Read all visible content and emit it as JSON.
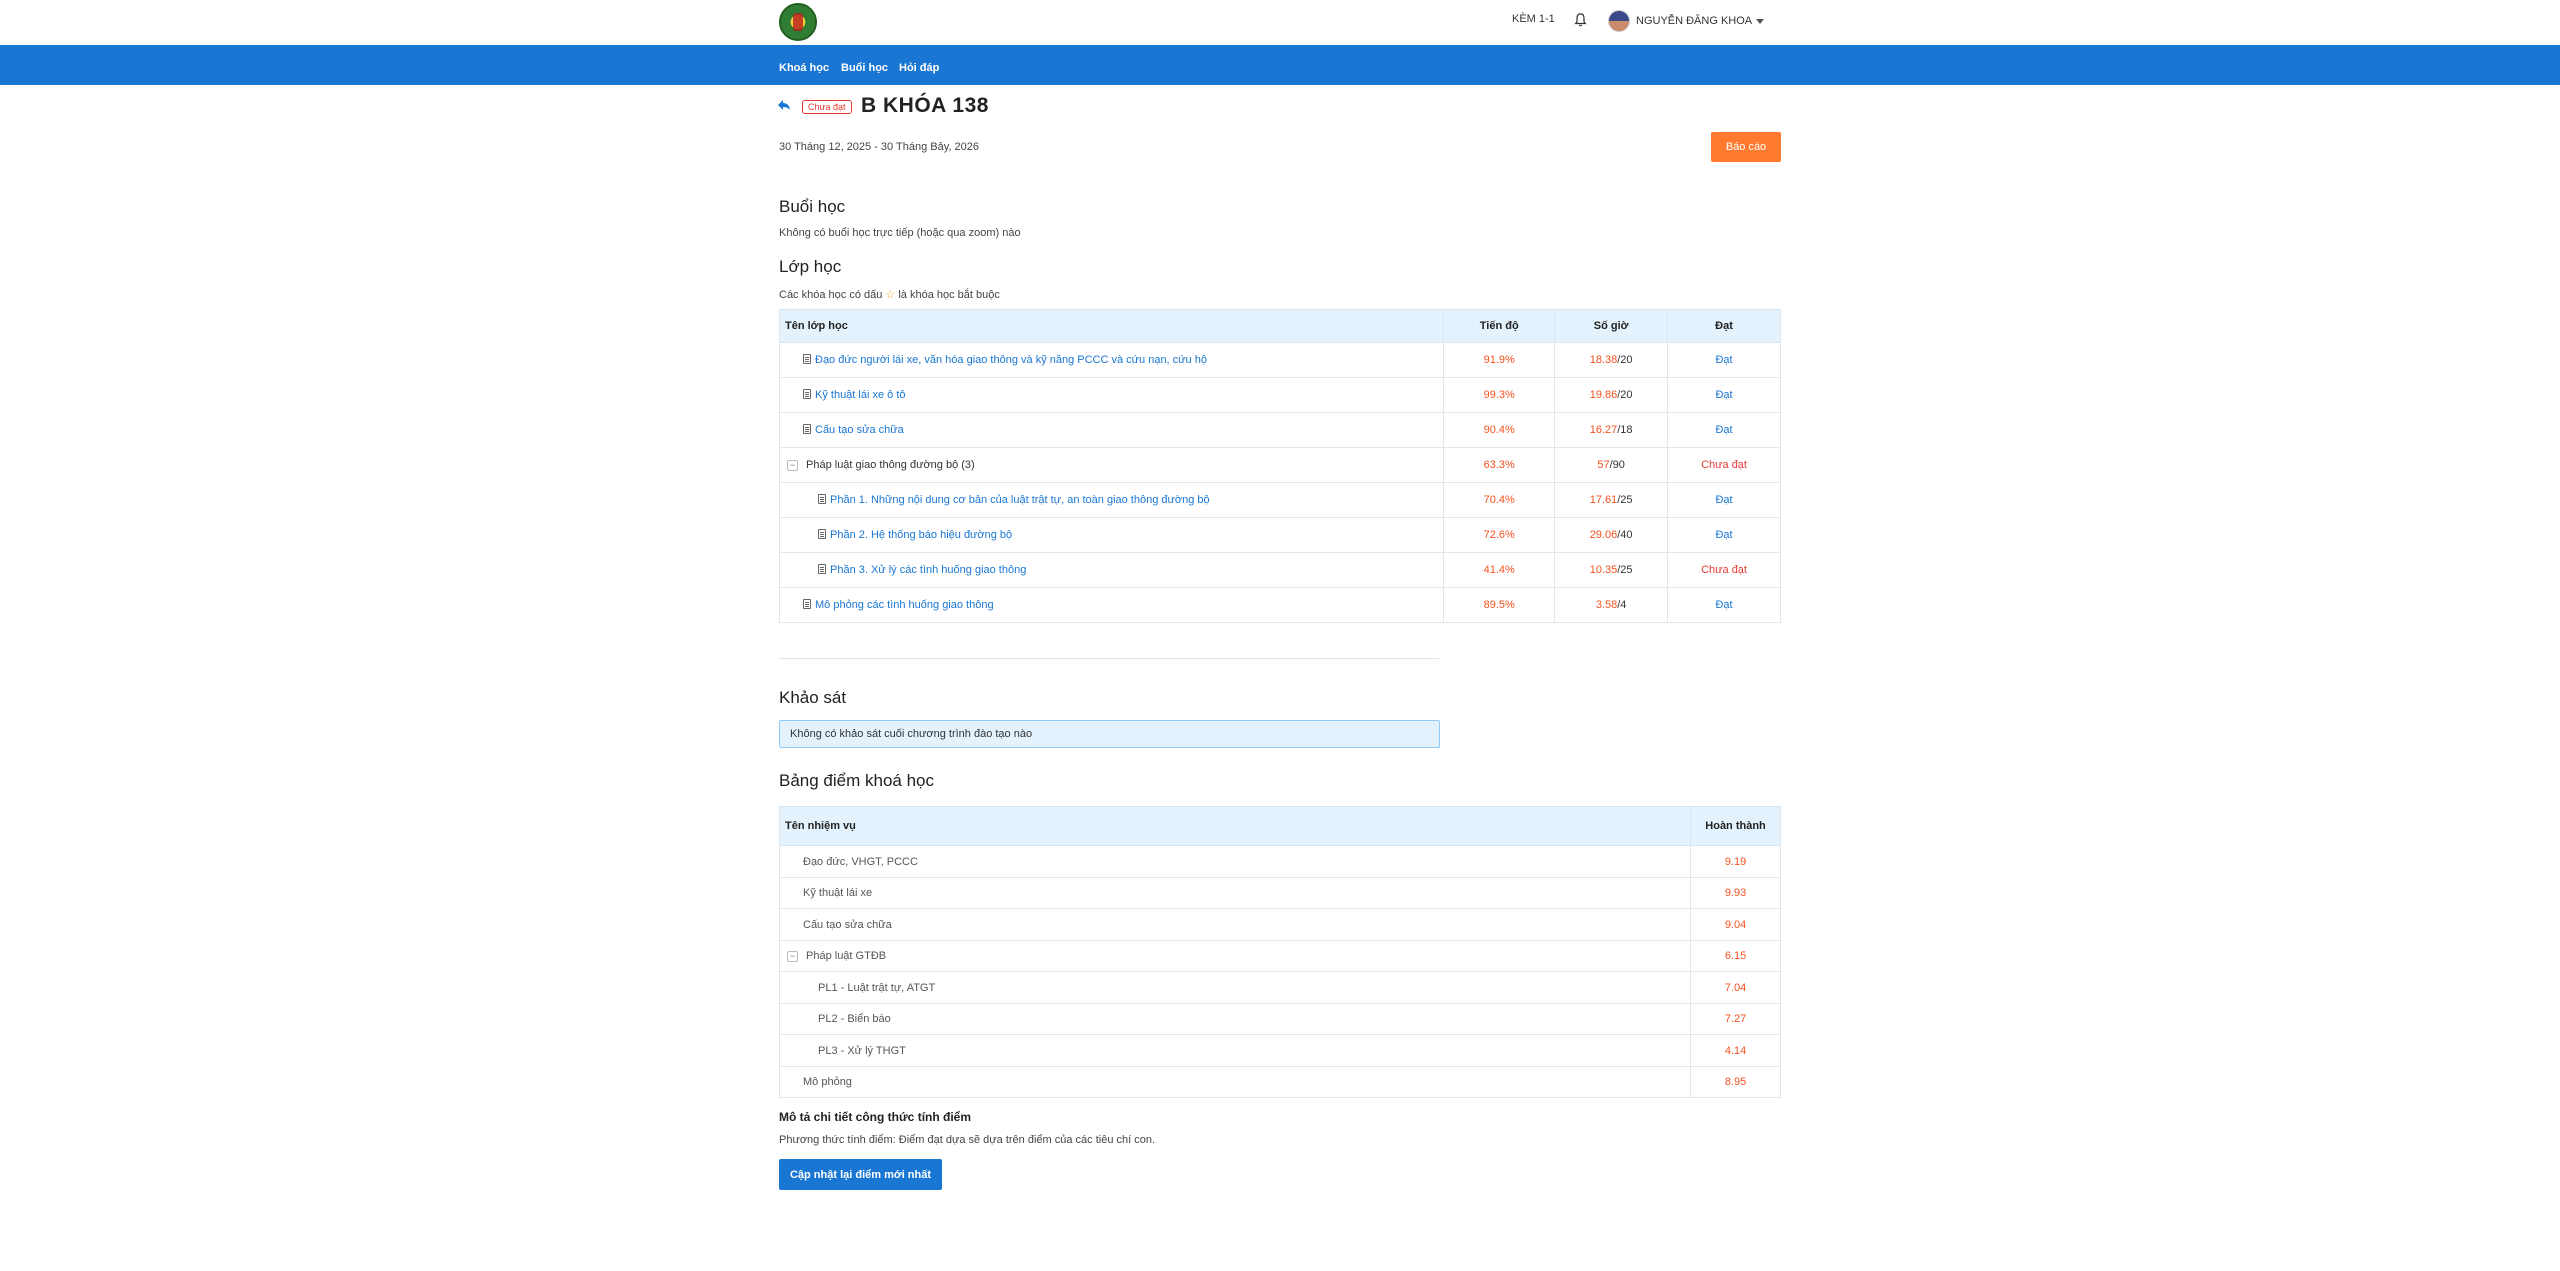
{
  "header": {
    "kem_label": "KÈM 1-1",
    "user_name": "NGUYỄN ĐĂNG KHOA"
  },
  "nav": {
    "items": [
      "Khoá học",
      "Buổi học",
      "Hỏi đáp"
    ]
  },
  "course": {
    "status_badge": "Chưa đạt",
    "title": "B KHÓA 138",
    "date_range": "30 Tháng 12, 2025 - 30 Tháng Bảy, 2026",
    "report_button": "Báo cáo"
  },
  "sessions": {
    "heading": "Buổi học",
    "empty_text": "Không có buổi học trực tiếp (hoặc qua zoom) nào"
  },
  "classes": {
    "heading": "Lớp học",
    "note_prefix": "Các khóa học có dấu",
    "note_star": "☆",
    "note_suffix": "là khóa học bắt buộc",
    "columns": [
      "Tên lớp học",
      "Tiến độ",
      "Số giờ",
      "Đạt"
    ],
    "rows": [
      {
        "name": "Đạo đức người lái xe, văn hóa giao thông và kỹ năng PCCC và cứu nạn, cứu hộ",
        "progress": "91.9%",
        "hours_done": "18.38",
        "hours_total": "/20",
        "status": "Đạt"
      },
      {
        "name": "Kỹ thuật lái xe ô tô",
        "progress": "99.3%",
        "hours_done": "19.86",
        "hours_total": "/20",
        "status": "Đạt"
      },
      {
        "name": "Cấu tạo sửa chữa",
        "progress": "90.4%",
        "hours_done": "16.27",
        "hours_total": "/18",
        "status": "Đạt"
      },
      {
        "name": "Pháp luật giao thông đường bộ",
        "count": "(3)",
        "progress": "63.3%",
        "hours_done": "57",
        "hours_total": "/90",
        "status": "Chưa đạt"
      },
      {
        "name": "Phần 1. Những nội dung cơ bản của luật trật tự, an toàn giao thông đường bộ",
        "progress": "70.4%",
        "hours_done": "17.61",
        "hours_total": "/25",
        "status": "Đạt"
      },
      {
        "name": "Phần 2. Hệ thống báo hiệu đường bộ",
        "progress": "72.6%",
        "hours_done": "29.06",
        "hours_total": "/40",
        "status": "Đạt"
      },
      {
        "name": "Phần 3. Xử lý các tình huống giao thông",
        "progress": "41.4%",
        "hours_done": "10.35",
        "hours_total": "/25",
        "status": "Chưa đạt"
      },
      {
        "name": "Mô phỏng các tình huống giao thông",
        "progress": "89.5%",
        "hours_done": "3.58",
        "hours_total": "/4",
        "status": "Đạt"
      }
    ]
  },
  "survey": {
    "heading": "Khảo sát",
    "empty_text": "Không có khảo sát cuối chương trình đào tạo nào"
  },
  "scores": {
    "heading": "Bảng điểm khoá học",
    "columns": [
      "Tên nhiệm vụ",
      "Hoàn thành"
    ],
    "rows": [
      {
        "name": "Đạo đức, VHGT, PCCC",
        "score": "9.19"
      },
      {
        "name": "Kỹ thuật lái xe",
        "score": "9.93"
      },
      {
        "name": "Cấu tạo sửa chữa",
        "score": "9.04"
      },
      {
        "name": "Pháp luật GTĐB",
        "score": "6.15"
      },
      {
        "name": "PL1 - Luật trật tự, ATGT",
        "score": "7.04"
      },
      {
        "name": "PL2 - Biển báo",
        "score": "7.27"
      },
      {
        "name": "PL3 - Xử lý THGT",
        "score": "4.14"
      },
      {
        "name": "Mô phỏng",
        "score": "8.95"
      }
    ]
  },
  "formula": {
    "title": "Mô tả chi tiết công thức tính điểm",
    "text": "Phương thức tính điểm: Điểm đạt dựa sẽ dựa trên điểm của các tiêu chí con.",
    "update_button": "Cập nhật lại điểm mới nhất"
  },
  "colors": {
    "primary": "#1976d2",
    "accent": "#ff7a2e",
    "danger": "#e53935",
    "table_header": "#e3f2fd"
  }
}
